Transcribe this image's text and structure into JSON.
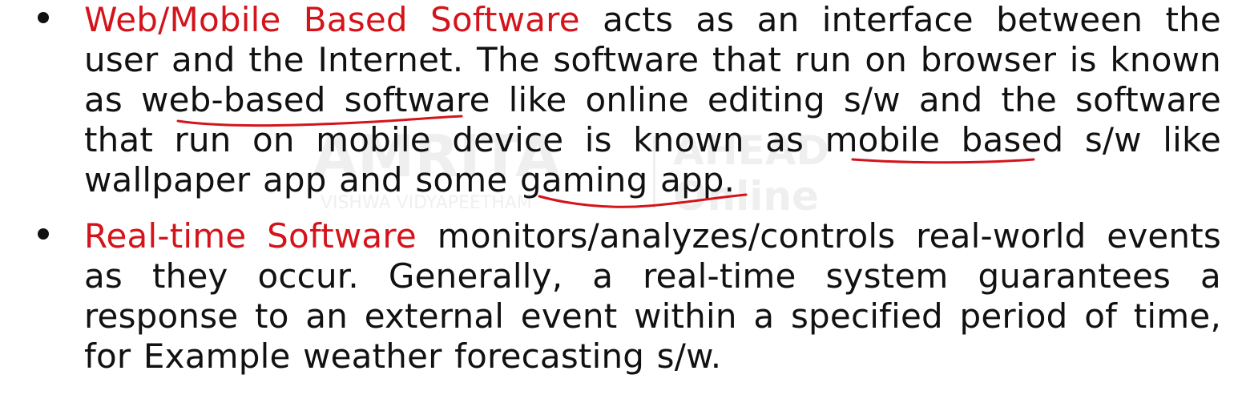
{
  "watermark": {
    "brand": "AMRITA",
    "product": "AHEAD",
    "mode": "Online",
    "sub": "VISHWA VIDYAPEETHAM"
  },
  "bullets": [
    {
      "term": "Web/Mobile Based Software",
      "t1": " acts as an interface between the user and the Internet. The software that run on browser is known as ",
      "mark1": "web-based software",
      "t2": " like online editing s/w and the software that run on mobile device is known as ",
      "mark2": "mobile based",
      "t3": " s/w like wallpaper app and some ",
      "mark3": "gaming app",
      "t4": "."
    },
    {
      "term": "Real-time Software",
      "t1": " monitors/analyzes/controls real-world events as they occur. Generally, a real-time system guarantees a response to an external event within a specified period of time, for Example weather forecasting s/w."
    }
  ],
  "colors": {
    "term": "#d4141b",
    "annotation_ink": "#d4141b",
    "text": "#111111",
    "background": "#ffffff"
  }
}
